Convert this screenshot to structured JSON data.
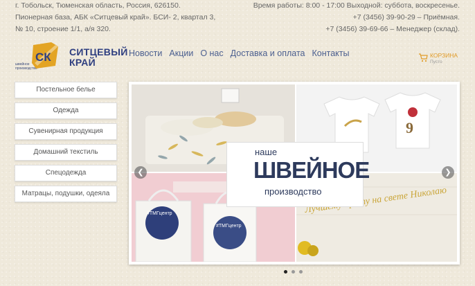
{
  "header": {
    "address": [
      "г. Тобольск, Тюменская область, Россия, 626150.",
      "Пионерная база, АБК «Ситцевый край». БСИ- 2, квартал 3,",
      "№ 10, строение 1/1, а/я 320."
    ],
    "hours": "Время работы: 8:00 - 17:00 Выходной: суббота, воскресенье.",
    "phone_reception": "+7 (3456) 39-90-29 – Приёмная.",
    "phone_manager": "+7 (3456) 39-69-66 – Менеджер (склад)."
  },
  "logo": {
    "mark": "СК",
    "name_line1": "СИТЦЕВЫЙ",
    "name_line2": "КРАЙ",
    "tagline": "швейное производство"
  },
  "nav": [
    "Новости",
    "Акции",
    "О нас",
    "Доставка и оплата",
    "Контакты"
  ],
  "cart": {
    "label": "КОРЗИНА",
    "status": "Пусто"
  },
  "sidebar": [
    "Постельное белье",
    "Одежда",
    "Сувенирная продукция",
    "Домашний текстиль",
    "Спецодежда",
    "Матрацы, подушки, одеяла"
  ],
  "slider": {
    "line1": "наше",
    "line2": "ШВЕЙНОЕ",
    "line3": "производство",
    "bag_label": "#ТМГцентр",
    "towel_text": "Лучшему брату на свете Николаю",
    "prev_icon": "chevron-left-icon",
    "next_icon": "chevron-right-icon",
    "slides": 3,
    "active_slide": 1
  },
  "colors": {
    "accent": "#e09a26",
    "nav": "#4b5f8f",
    "brand": "#2f3f80"
  }
}
